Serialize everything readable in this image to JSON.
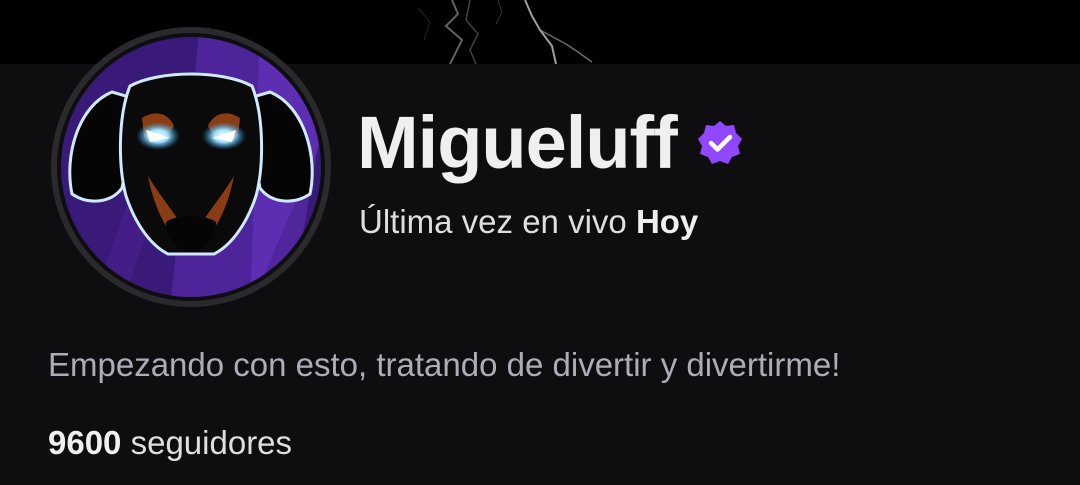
{
  "channel": {
    "name": "Migueluff",
    "verified": true,
    "last_live_label": "Última vez en vivo",
    "last_live_value": "Hoy",
    "bio": "Empezando con esto, tratando de divertir y divertirme!",
    "follower_count": "9600",
    "followers_label": "seguidores"
  },
  "icons": {
    "verified": "verified-badge-icon",
    "avatar": "doberman-dog-avatar",
    "banner": "lightning-banner"
  },
  "colors": {
    "background": "#0e0e10",
    "accent_purple": "#9147ff",
    "text_primary": "#efeff1",
    "text_muted": "#adadb8"
  }
}
